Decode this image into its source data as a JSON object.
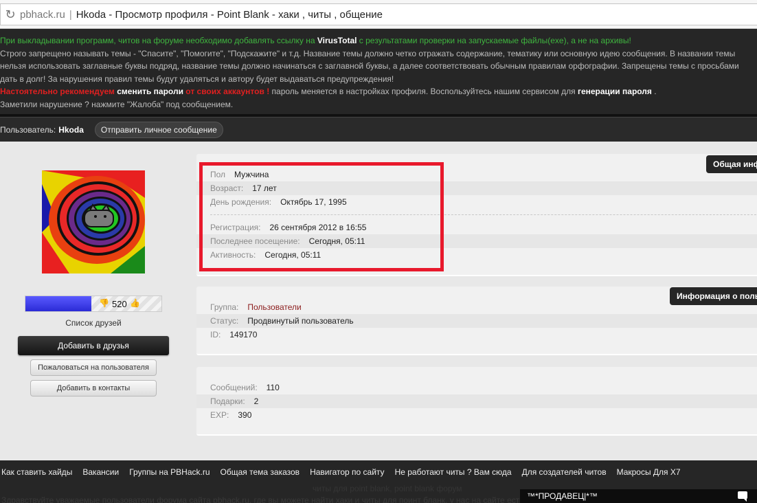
{
  "browser": {
    "domain": "pbhack.ru",
    "separator": "|",
    "title": "Hkoda - Просмотр профиля - Point Blank - хаки , читы , общение"
  },
  "notice": {
    "line1_pre": "При выкладывании программ, читов на форуме необходимо добавлять ссылку на ",
    "line1_link": "VirusTotal",
    "line1_post": " с результатами проверки на запускаемые файлы(exe), а не на архивы!",
    "line2": "Строго запрещено называть темы - \"Спасите\", \"Помогите\", \"Подскажите\" и т.д. Название темы должно четко отражать содержание, тематику или основную идею сообщения. В названии темы",
    "line3": "нельзя использовать заглавные буквы подряд, название темы должно начинаться с заглавной буквы, а далее соответствовать обычным правилам орфографии. Запрещены темы с просьбами",
    "line4": "дать в долг! За нарушения правил темы будут удаляться и автору будет выдаваться предупреждения!",
    "line5_red1": "Настоятельно рекомендуем",
    "line5_white1": "сменить пароли",
    "line5_red2": "от своих аккаунтов !",
    "line5_text": " пароль меняется в настройках профиля. Воспользуйтесь нашим сервисом для ",
    "line5_white2": "генерации пароля",
    "line5_end": " .",
    "line6": "Заметили нарушение ? нажмите \"Жалоба\" под сообщением."
  },
  "userbar": {
    "label": "Пользователь:",
    "name": "Hkoda",
    "pm_button": "Отправить личное сообщение"
  },
  "sidebar": {
    "reputation": "520",
    "friends_list": "Список друзей",
    "add_friend": "Добавить в друзья",
    "complain": "Пожаловаться на пользователя",
    "add_contact": "Добавить в контакты"
  },
  "general": {
    "tab": "Общая информация",
    "gender_label": "Пол",
    "gender": "Мужчина",
    "age_label": "Возраст:",
    "age": "17 лет",
    "birthday_label": "День рождения:",
    "birthday": "Октябрь 17, 1995",
    "registered_label": "Регистрация:",
    "registered": "26 сентября 2012 в 16:55",
    "last_visit_label": "Последнее посещение:",
    "last_visit": "Сегодня, 05:11",
    "activity_label": "Активность:",
    "activity": "Сегодня, 05:11"
  },
  "info": {
    "tab": "Информация о пользователе",
    "group_label": "Группа:",
    "group": "Пользователи",
    "status_label": "Статус:",
    "status": "Продвинутый пользователь",
    "id_label": "ID:",
    "id": "149170"
  },
  "stats": {
    "posts_label": "Сообщений:",
    "posts": "110",
    "gifts_label": "Подарки:",
    "gifts": "2",
    "exp_label": "EXP:",
    "exp": "390"
  },
  "footer": {
    "links": [
      "Как ставить хайды",
      "Вакансии",
      "Группы на PBHack.ru",
      "Общая тема заказов",
      "Навигатор по сайту",
      "Не работают читы ? Вам сюда",
      "Для создателей читов",
      "Макросы Для X7"
    ],
    "ghost1": "читы для point blank, point blank форум",
    "ghost2": "Здравствуйте уважаемые пользователи форума сайта pbhack.ru, где вы можете найти хаки и читы для поинт бланк, у нас на сайте есть",
    "chat": "™*ПРОДАВЕЦ|*™"
  },
  "colors": {
    "highlight": "#e8192c",
    "notice_green": "#3fb53f",
    "notice_red": "#e02020",
    "reputation_bar": "#2b2bd6"
  }
}
